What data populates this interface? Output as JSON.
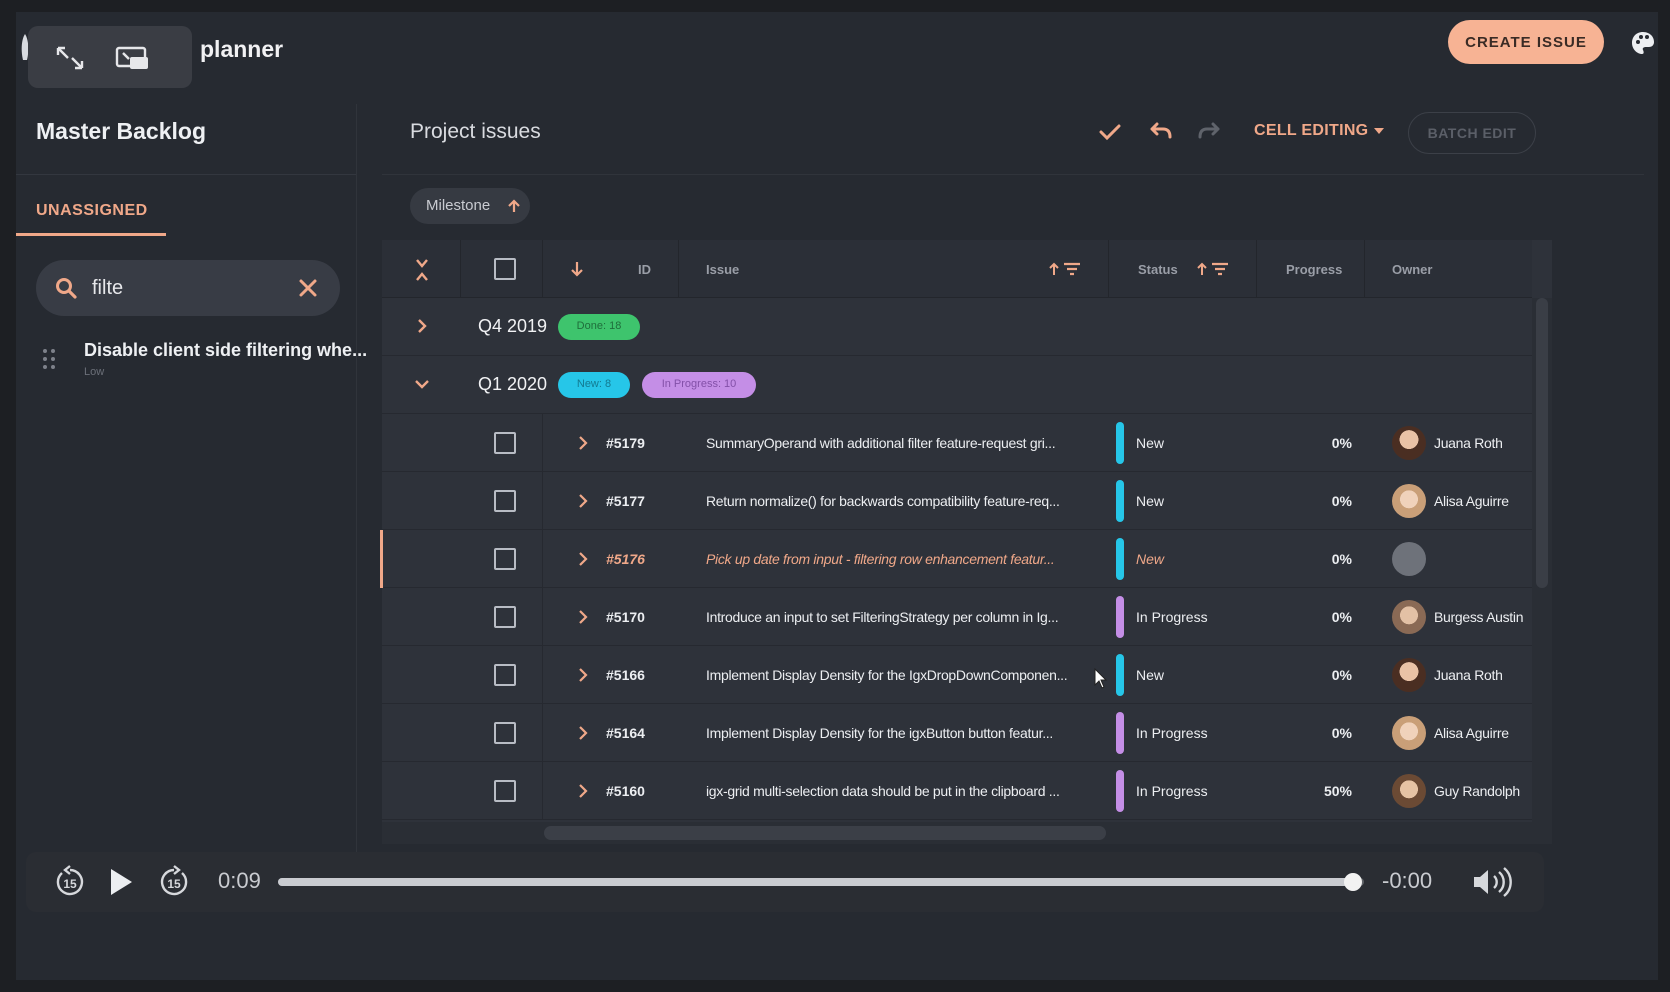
{
  "app": {
    "title": "planner"
  },
  "pip": {
    "icons": [
      "expand-icon",
      "picture-in-picture-icon"
    ]
  },
  "topbar": {
    "create_label": "CREATE ISSUE",
    "accent": "#f7b394"
  },
  "sidebar": {
    "title": "Master Backlog",
    "tab": "UNASSIGNED",
    "search": {
      "value": "filte"
    },
    "items": [
      {
        "title": "Disable client side filtering whe...",
        "priority": "Low"
      }
    ]
  },
  "main": {
    "title": "Project issues",
    "cell_editing": "CELL EDITING",
    "batch_edit": "BATCH EDIT",
    "group_chip": "Milestone"
  },
  "grid": {
    "columns": {
      "id": "ID",
      "issue": "Issue",
      "status": "Status",
      "progress": "Progress",
      "owner": "Owner"
    },
    "groups": [
      {
        "label": "Q4 2019",
        "expanded": false,
        "badges": [
          {
            "text": "Done: 18",
            "color": "#3ec46d"
          }
        ]
      },
      {
        "label": "Q1 2020",
        "expanded": true,
        "badges": [
          {
            "text": "New: 8",
            "color": "#26c6e8"
          },
          {
            "text": "In Progress: 10",
            "color": "#c48ee6"
          }
        ]
      }
    ],
    "rows": [
      {
        "id": "#5179",
        "issue": "SummaryOperand with additional filter feature-request gri...",
        "status": "New",
        "status_color": "#26c6e8",
        "progress": "0%",
        "owner": "Juana Roth",
        "selected": false
      },
      {
        "id": "#5177",
        "issue": "Return normalize() for backwards compatibility feature-req...",
        "status": "New",
        "status_color": "#26c6e8",
        "progress": "0%",
        "owner": "Alisa Aguirre",
        "selected": false
      },
      {
        "id": "#5176",
        "issue": "Pick up date from input - filtering row enhancement featur...",
        "status": "New",
        "status_color": "#26c6e8",
        "progress": "0%",
        "owner": "",
        "selected": true
      },
      {
        "id": "#5170",
        "issue": "Introduce an input to set FilteringStrategy per column in Ig...",
        "status": "In Progress",
        "status_color": "#c48ee6",
        "progress": "0%",
        "owner": "Burgess Austin",
        "selected": false
      },
      {
        "id": "#5166",
        "issue": "Implement Display Density for the IgxDropDownComponen...",
        "status": "New",
        "status_color": "#26c6e8",
        "progress": "0%",
        "owner": "Juana Roth",
        "selected": false
      },
      {
        "id": "#5164",
        "issue": "Implement Display Density for the igxButton button featur...",
        "status": "In Progress",
        "status_color": "#c48ee6",
        "progress": "0%",
        "owner": "Alisa Aguirre",
        "selected": false
      },
      {
        "id": "#5160",
        "issue": "igx-grid multi-selection data should be put in the clipboard ...",
        "status": "In Progress",
        "status_color": "#c48ee6",
        "progress": "50%",
        "owner": "Guy Randolph",
        "selected": false
      }
    ]
  },
  "video": {
    "elapsed": "0:09",
    "remaining": "-0:00",
    "progress": 0.99,
    "skip_back": "15",
    "skip_fwd": "15"
  }
}
